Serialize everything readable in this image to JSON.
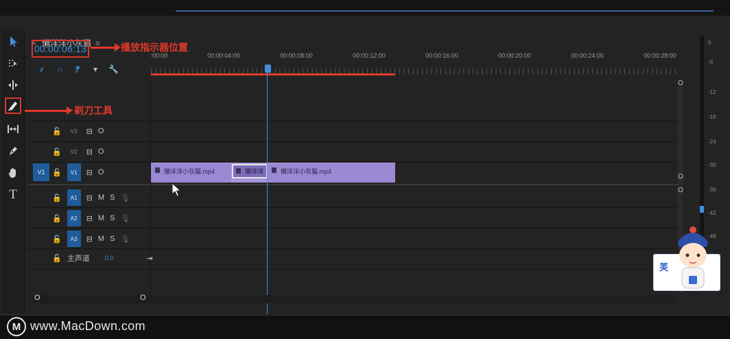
{
  "timeline": {
    "sequence_tab": "懒洋洋小灰猫",
    "close_glyph": "×",
    "menu_glyph": "≡",
    "timecode": "00:00:06:13",
    "ruler_labels": [
      ":00:00",
      "00:00:04:00",
      "00:00:08:00",
      "00:00:12:00",
      "00:00:16:00",
      "00:00:20:00",
      "00:00:24:00",
      "00:00:28:00"
    ],
    "tool_glyphs": [
      "⸙",
      "∩",
      "⁋",
      "▾",
      "🔧"
    ],
    "playhead_time_fraction": 0.217
  },
  "annotations": {
    "playhead_note": "播放指示器位置",
    "razor_note": "剃刀工具"
  },
  "tracks": {
    "video": [
      {
        "name": "V3",
        "lock": "🔓",
        "sync": "⊟",
        "eye": "O"
      },
      {
        "name": "V2",
        "lock": "🔓",
        "sync": "⊟",
        "eye": "O"
      },
      {
        "name": "V1",
        "lock": "🔓",
        "sync": "⊟",
        "eye": "O",
        "source": "V1"
      }
    ],
    "audio": [
      {
        "name": "A1",
        "lock": "🔓",
        "sync": "⊟",
        "mute": "M",
        "solo": "S",
        "mic": "🎙"
      },
      {
        "name": "A2",
        "lock": "🔓",
        "sync": "⊟",
        "mute": "M",
        "solo": "S",
        "mic": "🎙"
      },
      {
        "name": "A3",
        "lock": "🔓",
        "sync": "⊟",
        "mute": "M",
        "solo": "S",
        "mic": "🎙"
      }
    ],
    "master": {
      "lock": "🔓",
      "label": "主声道",
      "value": "0.0",
      "end_glyph": "⇥"
    }
  },
  "clips": [
    {
      "label": "懒洋洋小灰猫.mp4"
    },
    {
      "label": "懒洋洋"
    },
    {
      "label": "懒洋洋小灰猫.mp4"
    }
  ],
  "scroll": {
    "left_o": "O",
    "right_o": "O",
    "v_o_top": "O",
    "v_o_mid": "O",
    "v_o_bottom": "O"
  },
  "meter": {
    "labels": [
      "0",
      "-6",
      "-12",
      "-18",
      "-24",
      "-30",
      "-36",
      "-42",
      "-48"
    ]
  },
  "mascot": {
    "card_text": "芙"
  },
  "footer": {
    "logo": "M",
    "site": "www.MacDown.com"
  },
  "colors": {
    "accent_blue": "#3f8fe0",
    "clip_purple": "#9b88d3",
    "annotation_red": "#e2382c"
  }
}
